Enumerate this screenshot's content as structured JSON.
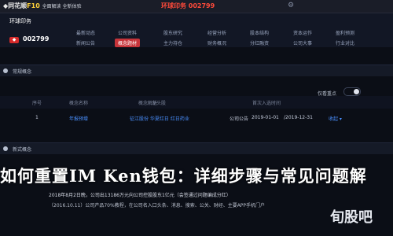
{
  "topbar": {
    "app_name_prefix": "◆同花顺",
    "app_name_suffix": "F10",
    "app_tagline": "全面解读 全新体验",
    "title": "环球印务 002799",
    "settings_icon": "gear-icon"
  },
  "stock": {
    "name": "环球印务",
    "badge": "◆",
    "code": "002799"
  },
  "menu": {
    "row1": [
      "最新动态",
      "公司资料",
      "股东研究",
      "经营分析",
      "股本结构",
      "资本运作",
      "盈利预测"
    ],
    "row2": [
      "新闻公告",
      "概念题材",
      "主力持仓",
      "财务概况",
      "分红融资",
      "公司大事",
      "行业对比"
    ],
    "active": "概念题材"
  },
  "sections": {
    "concept": {
      "title": "常规概念",
      "toggle_label": "仅看重点"
    },
    "news": {
      "title": "新式概念"
    }
  },
  "table": {
    "headers": [
      "序号",
      "概念名称",
      "概念解析",
      "龙头股",
      "",
      "首次入选时间"
    ],
    "rows": [
      {
        "index": "1",
        "concept": "年报预增",
        "analysis": "",
        "leaders": "征江股份 华夏红日 红日药业",
        "company": "公司公告",
        "date": "2019-01-01",
        "date_tail": "/2019-12-31",
        "expand": "收起 ▾"
      }
    ]
  },
  "article": {
    "headline": "如何重置IM Ken钱包：详细步骤与常见问题解",
    "line1": "2018年8月2日晚，公司出13186万元向公司控股股东1亿元（会签通过问题编成分红）",
    "line2": "（2016.10.11）公司产品70%教程，在公司名入口头条、消息、搜索、公关、财经、主要APP手机门户"
  },
  "watermark": {
    "text": "旬股吧"
  }
}
